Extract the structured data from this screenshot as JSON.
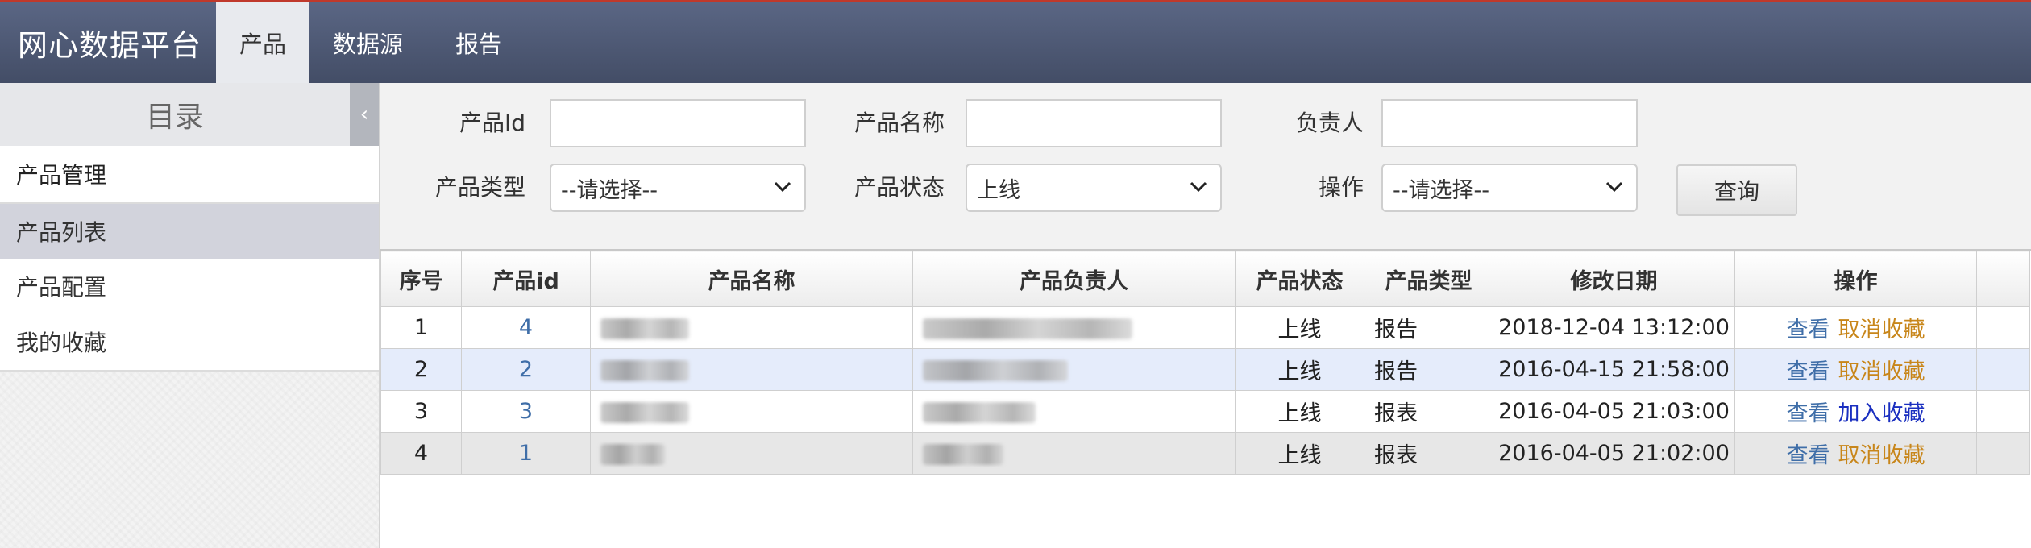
{
  "header": {
    "brand": "网心数据平台",
    "tabs": [
      {
        "label": "产品",
        "active": true
      },
      {
        "label": "数据源",
        "active": false
      },
      {
        "label": "报告",
        "active": false
      }
    ],
    "accent_color": "#c0392b",
    "bar_color": "#4e5874"
  },
  "sidebar": {
    "title": "目录",
    "collapse_icon": "‹",
    "group_label": "产品管理",
    "items": [
      {
        "label": "产品列表",
        "active": true
      },
      {
        "label": "产品配置",
        "active": false
      },
      {
        "label": "我的收藏",
        "active": false
      }
    ]
  },
  "filters": {
    "product_id_label": "产品Id",
    "product_id_value": "",
    "product_name_label": "产品名称",
    "product_name_value": "",
    "owner_label": "负责人",
    "owner_value": "",
    "product_type_label": "产品类型",
    "product_type_value": "--请选择--",
    "product_status_label": "产品状态",
    "product_status_value": "上线",
    "operation_label": "操作",
    "operation_value": "--请选择--",
    "query_button": "查询"
  },
  "table": {
    "columns": [
      "序号",
      "产品id",
      "产品名称",
      "产品负责人",
      "产品状态",
      "产品类型",
      "修改日期",
      "操作"
    ],
    "rows": [
      {
        "seq": "1",
        "id": "4",
        "status": "上线",
        "type": "报告",
        "modified": "2018-12-04 13:12:00",
        "view": "查看",
        "fav_action": "取消收藏",
        "favorited": true
      },
      {
        "seq": "2",
        "id": "2",
        "status": "上线",
        "type": "报告",
        "modified": "2016-04-15 21:58:00",
        "view": "查看",
        "fav_action": "取消收藏",
        "favorited": true
      },
      {
        "seq": "3",
        "id": "3",
        "status": "上线",
        "type": "报表",
        "modified": "2016-04-05 21:03:00",
        "view": "查看",
        "fav_action": "加入收藏",
        "favorited": false
      },
      {
        "seq": "4",
        "id": "1",
        "status": "上线",
        "type": "报表",
        "modified": "2016-04-05 21:02:00",
        "view": "查看",
        "fav_action": "取消收藏",
        "favorited": true
      }
    ]
  },
  "colors": {
    "link": "#3f6ea8",
    "unfavorite": "#c8861a",
    "favorite": "#1a2fc0",
    "selected_row": "#e5ecfb",
    "active_menu": "#d2d3dc"
  }
}
